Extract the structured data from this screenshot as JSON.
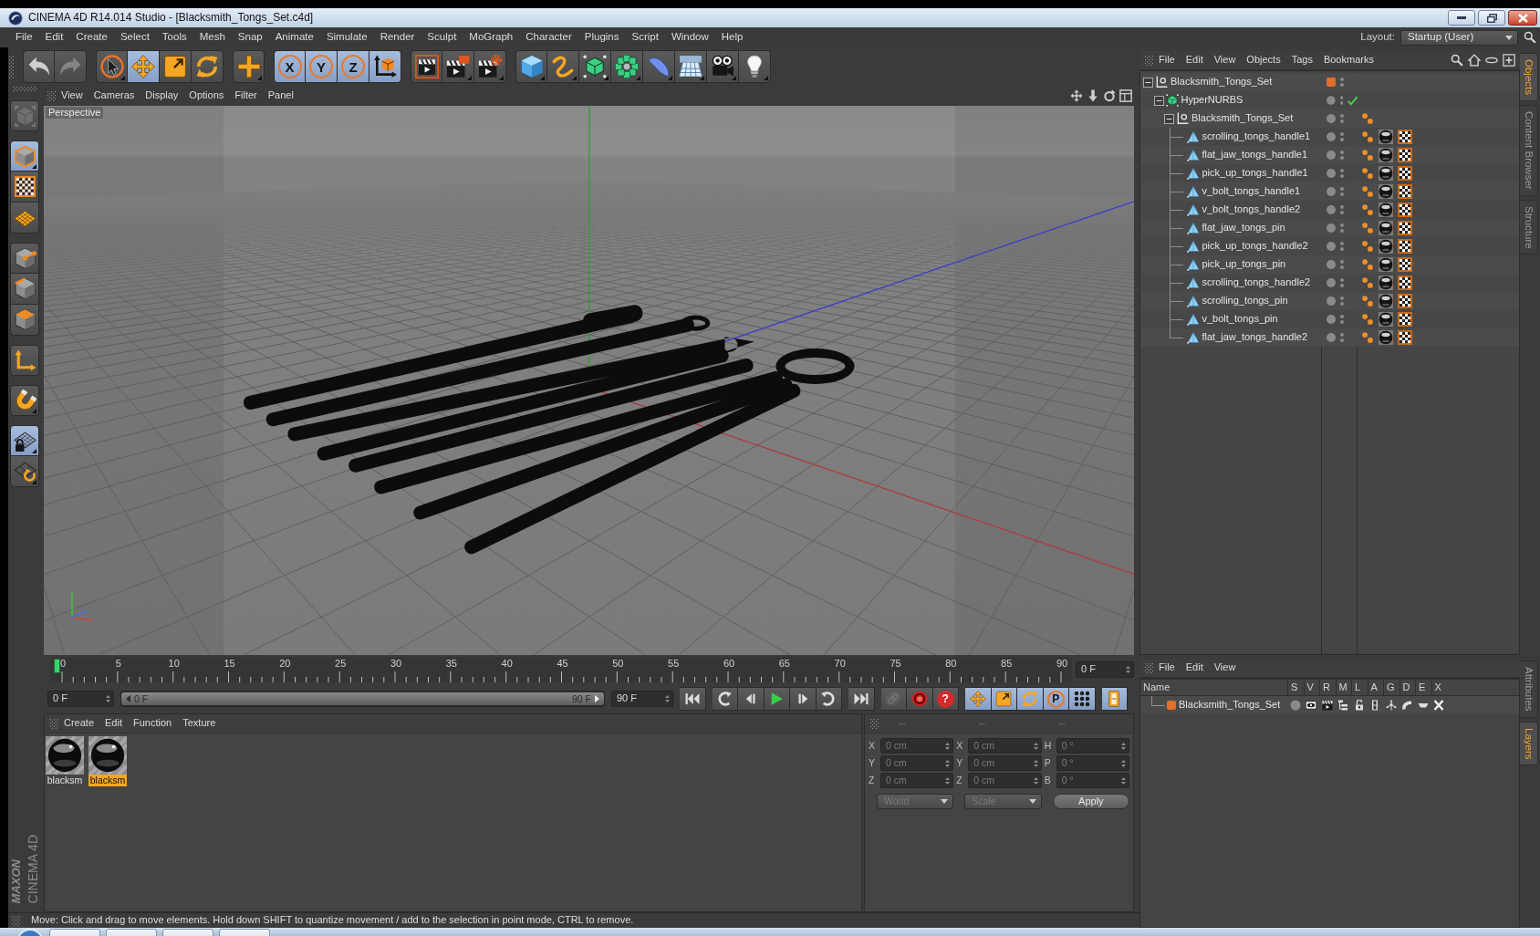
{
  "window": {
    "title": "CINEMA 4D R14.014 Studio - [Blacksmith_Tongs_Set.c4d]"
  },
  "menu_bar": [
    "File",
    "Edit",
    "Create",
    "Select",
    "Tools",
    "Mesh",
    "Snap",
    "Animate",
    "Simulate",
    "Render",
    "Sculpt",
    "MoGraph",
    "Character",
    "Plugins",
    "Script",
    "Window",
    "Help"
  ],
  "layout_picker": {
    "label": "Layout:",
    "value": "Startup (User)"
  },
  "toolbar": [
    [
      {
        "kind": "undo",
        "selected": false,
        "disabled": false
      },
      {
        "kind": "redo",
        "selected": false,
        "disabled": true
      }
    ],
    [
      {
        "kind": "live_select",
        "selected": false
      },
      {
        "kind": "move",
        "selected": true
      },
      {
        "kind": "scale",
        "selected": false
      },
      {
        "kind": "rotate",
        "selected": false
      }
    ],
    [
      {
        "kind": "recent_tool",
        "selected": false
      }
    ],
    [
      {
        "kind": "axis_lock",
        "label": "X",
        "selected": true
      },
      {
        "kind": "axis_lock",
        "label": "Y",
        "selected": true
      },
      {
        "kind": "axis_lock",
        "label": "Z",
        "selected": true
      },
      {
        "kind": "coord_system",
        "selected": true
      }
    ],
    [
      {
        "kind": "render_view",
        "selected": false
      },
      {
        "kind": "render_picture",
        "selected": false
      },
      {
        "kind": "render_settings",
        "selected": false
      }
    ],
    [
      {
        "kind": "cube",
        "selected": false
      },
      {
        "kind": "spline",
        "selected": false
      },
      {
        "kind": "nurbs",
        "selected": false
      },
      {
        "kind": "array",
        "selected": false
      },
      {
        "kind": "deformer",
        "selected": false
      },
      {
        "kind": "floor",
        "selected": false
      },
      {
        "kind": "camera",
        "selected": false
      },
      {
        "kind": "light",
        "selected": false
      }
    ]
  ],
  "left_tools": [
    [
      {
        "kind": "make_editable",
        "selected": false,
        "disabled": true
      }
    ],
    [
      {
        "kind": "model",
        "selected": true
      },
      {
        "kind": "texture",
        "selected": false
      },
      {
        "kind": "workplane",
        "selected": false
      }
    ],
    [
      {
        "kind": "points",
        "selected": false
      },
      {
        "kind": "edges",
        "selected": false
      },
      {
        "kind": "polygons",
        "selected": false
      }
    ],
    [
      {
        "kind": "axis",
        "selected": false
      }
    ],
    [
      {
        "kind": "snap",
        "selected": false
      }
    ],
    [
      {
        "kind": "locked_workplane",
        "selected": true
      },
      {
        "kind": "planar_workplane",
        "selected": false
      }
    ]
  ],
  "viewport": {
    "menu": [
      "View",
      "Cameras",
      "Display",
      "Options",
      "Filter",
      "Panel"
    ],
    "camera": "Perspective"
  },
  "timeline": {
    "ticks": [
      "0",
      "5",
      "10",
      "15",
      "20",
      "25",
      "30",
      "35",
      "40",
      "45",
      "50",
      "55",
      "60",
      "65",
      "70",
      "75",
      "80",
      "85",
      "90"
    ],
    "playhead": {
      "level": 0
    },
    "current_frame": "0 F"
  },
  "transport": {
    "start": "0 F",
    "range": {
      "start": "0 F",
      "end": "90 F",
      "level": 1
    },
    "end": "90 F",
    "buttons": [
      [
        {
          "kind": "go_start",
          "selected": false
        }
      ],
      [
        {
          "kind": "prev_key",
          "selected": false
        },
        {
          "kind": "prev_frame",
          "selected": false
        },
        {
          "kind": "play",
          "selected": false
        },
        {
          "kind": "next_frame",
          "selected": false
        },
        {
          "kind": "next_key",
          "selected": false
        }
      ],
      [
        {
          "kind": "go_end",
          "selected": false
        }
      ],
      [
        {
          "kind": "link",
          "selected": false,
          "disabled": true
        },
        {
          "kind": "record",
          "selected": false,
          "disabled": false
        },
        {
          "kind": "key_help",
          "label": "?",
          "selected": false,
          "disabled": false
        }
      ],
      [
        {
          "kind": "key_move",
          "selected": true
        },
        {
          "kind": "key_scale",
          "selected": true
        },
        {
          "kind": "key_rotate",
          "selected": true
        },
        {
          "kind": "key_param",
          "label": "P",
          "selected": true
        },
        {
          "kind": "key_points",
          "selected": true
        }
      ],
      [
        {
          "kind": "timeline",
          "selected": true
        }
      ]
    ]
  },
  "materials": {
    "menu": [
      "Create",
      "Edit",
      "Function",
      "Texture"
    ],
    "items": [
      {
        "name": "blacksm",
        "selected": false
      },
      {
        "name": "blacksm",
        "selected": true
      }
    ]
  },
  "coordinates": {
    "headers": [
      "--",
      "--",
      "--"
    ],
    "disabled": true,
    "rows": [
      [
        {
          "axis": "X",
          "value": "0 cm"
        },
        {
          "axis": "X",
          "value": "0 cm"
        },
        {
          "axis": "H",
          "value": "0 °"
        }
      ],
      [
        {
          "axis": "Y",
          "value": "0 cm"
        },
        {
          "axis": "Y",
          "value": "0 cm"
        },
        {
          "axis": "P",
          "value": "0 °"
        }
      ],
      [
        {
          "axis": "Z",
          "value": "0 cm"
        },
        {
          "axis": "Z",
          "value": "0 cm"
        },
        {
          "axis": "B",
          "value": "0 °"
        }
      ]
    ],
    "mode": "World",
    "transform": "Scale",
    "apply": "Apply"
  },
  "brand": {
    "maker": "MAXON",
    "product": "CINEMA 4D"
  },
  "status_bar": "Move: Click and drag to move elements. Hold down SHIFT to quantize movement / add to the selection in point mode, CTRL to remove.",
  "objects": {
    "menu": [
      "File",
      "Edit",
      "View",
      "Objects",
      "Tags",
      "Bookmarks"
    ],
    "tree": [
      {
        "name": "Blacksmith_Tongs_Set",
        "kind": "null",
        "expanded": true,
        "color": "#e0702c",
        "children": [
          {
            "name": "HyperNURBS",
            "kind": "generator",
            "expanded": true,
            "enabled": true,
            "children": [
              {
                "name": "Blacksmith_Tongs_Set",
                "kind": "null",
                "expanded": true,
                "tags": [
                  {
                    "kind": "phong"
                  }
                ],
                "children": [
                  {
                    "name": "scrolling_tongs_handle1",
                    "kind": "polygon",
                    "tags": [
                      {
                        "kind": "phong"
                      },
                      {
                        "kind": "material"
                      },
                      {
                        "kind": "texture"
                      }
                    ]
                  },
                  {
                    "name": "flat_jaw_tongs_handle1",
                    "kind": "polygon",
                    "tags": [
                      {
                        "kind": "phong"
                      },
                      {
                        "kind": "material"
                      },
                      {
                        "kind": "texture"
                      }
                    ]
                  },
                  {
                    "name": "pick_up_tongs_handle1",
                    "kind": "polygon",
                    "tags": [
                      {
                        "kind": "phong"
                      },
                      {
                        "kind": "material"
                      },
                      {
                        "kind": "texture"
                      }
                    ]
                  },
                  {
                    "name": "v_bolt_tongs_handle1",
                    "kind": "polygon",
                    "tags": [
                      {
                        "kind": "phong"
                      },
                      {
                        "kind": "material"
                      },
                      {
                        "kind": "texture"
                      }
                    ]
                  },
                  {
                    "name": "v_bolt_tongs_handle2",
                    "kind": "polygon",
                    "tags": [
                      {
                        "kind": "phong"
                      },
                      {
                        "kind": "material"
                      },
                      {
                        "kind": "texture"
                      }
                    ]
                  },
                  {
                    "name": "flat_jaw_tongs_pin",
                    "kind": "polygon",
                    "tags": [
                      {
                        "kind": "phong"
                      },
                      {
                        "kind": "material"
                      },
                      {
                        "kind": "texture"
                      }
                    ]
                  },
                  {
                    "name": "pick_up_tongs_handle2",
                    "kind": "polygon",
                    "tags": [
                      {
                        "kind": "phong"
                      },
                      {
                        "kind": "material"
                      },
                      {
                        "kind": "texture"
                      }
                    ]
                  },
                  {
                    "name": "pick_up_tongs_pin",
                    "kind": "polygon",
                    "tags": [
                      {
                        "kind": "phong"
                      },
                      {
                        "kind": "material"
                      },
                      {
                        "kind": "texture"
                      }
                    ]
                  },
                  {
                    "name": "scrolling_tongs_handle2",
                    "kind": "polygon",
                    "tags": [
                      {
                        "kind": "phong"
                      },
                      {
                        "kind": "material"
                      },
                      {
                        "kind": "texture"
                      }
                    ]
                  },
                  {
                    "name": "scrolling_tongs_pin",
                    "kind": "polygon",
                    "tags": [
                      {
                        "kind": "phong"
                      },
                      {
                        "kind": "material"
                      },
                      {
                        "kind": "texture"
                      }
                    ]
                  },
                  {
                    "name": "v_bolt_tongs_pin",
                    "kind": "polygon",
                    "tags": [
                      {
                        "kind": "phong"
                      },
                      {
                        "kind": "material"
                      },
                      {
                        "kind": "texture"
                      }
                    ]
                  },
                  {
                    "name": "flat_jaw_tongs_handle2",
                    "kind": "polygon",
                    "tags": [
                      {
                        "kind": "phong"
                      },
                      {
                        "kind": "material"
                      },
                      {
                        "kind": "texture"
                      }
                    ]
                  }
                ]
              }
            ]
          }
        ]
      }
    ]
  },
  "layers": {
    "menu": [
      "File",
      "Edit",
      "View"
    ],
    "columns": [
      "Name",
      "S",
      "V",
      "R",
      "M",
      "L",
      "A",
      "G",
      "D",
      "E",
      "X"
    ],
    "rows": [
      {
        "name": "Blacksmith_Tongs_Set",
        "color": "#e0702c",
        "switches": [
          {
            "kind": "solo",
            "on": false
          },
          {
            "kind": "view",
            "on": true
          },
          {
            "kind": "render",
            "on": true
          },
          {
            "kind": "manager",
            "on": true
          },
          {
            "kind": "locked",
            "on": false
          },
          {
            "kind": "animation",
            "on": true
          },
          {
            "kind": "generators",
            "on": true
          },
          {
            "kind": "deformers",
            "on": true
          },
          {
            "kind": "expressions",
            "on": true
          },
          {
            "kind": "xref",
            "on": true
          }
        ]
      }
    ]
  },
  "side_tabs": {
    "upper": [
      {
        "label": "Objects",
        "selected": true
      },
      {
        "label": "Content Browser",
        "selected": false
      },
      {
        "label": "Structure",
        "selected": false
      }
    ],
    "lower": [
      {
        "label": "Attributes",
        "selected": false
      },
      {
        "label": "Layers",
        "selected": true
      }
    ]
  }
}
